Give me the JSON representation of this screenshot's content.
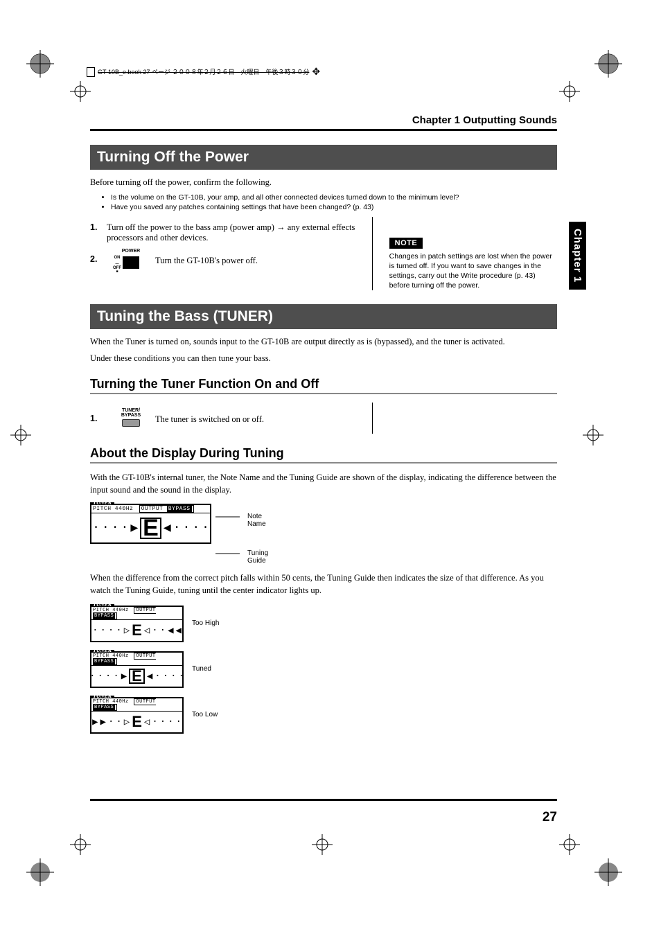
{
  "meta": {
    "header_line": "GT-10B_e.book  27 ページ  ２００８年２月２６日　火曜日　午後３時３０分"
  },
  "chapter_header": "Chapter 1 Outputting Sounds",
  "side_tab": "Chapter 1",
  "page_number": "27",
  "section1": {
    "title": "Turning Off the Power",
    "intro": "Before turning off the power, confirm the following.",
    "bullets": [
      "Is the volume on the GT-10B, your amp, and all other connected devices turned down to the minimum level?",
      "Have you saved any patches containing settings that have been changed? (p. 43)"
    ],
    "step1_num": "1.",
    "step1": "Turn off the power to the bass amp (power amp) → any external effects processors and other devices.",
    "step2_num": "2.",
    "step2_icon_top": "POWER",
    "step2_on": "ON",
    "step2_off": "OFF",
    "step2": "Turn the GT-10B's power off.",
    "note_label": "NOTE",
    "note": "Changes in patch settings are lost when the power is turned off. If you want to save changes in the settings, carry out the Write procedure (p. 43) before turning off the power."
  },
  "section2": {
    "title": "Tuning the Bass (TUNER)",
    "p1": "When the Tuner is turned on, sounds input to the GT-10B are output directly as is (bypassed), and the tuner is activated.",
    "p2": "Under these conditions you can then tune your bass.",
    "sub1": {
      "title": "Turning the Tuner Function On and Off",
      "step1_num": "1.",
      "step1_icon_top": "TUNER/\nBYPASS",
      "step1": "The tuner is switched on or off."
    },
    "sub2": {
      "title": "About the Display During Tuning",
      "p1": "With the GT-10B's internal tuner, the Note Name and the Tuning Guide are shown of the display, indicating the difference between the input sound and the sound in the display.",
      "callout_note_name": "Note Name",
      "callout_tuning_guide": "Tuning Guide",
      "p2": "When the difference from the correct pitch falls within 50 cents, the Tuning Guide then indicates the size of that difference. As you watch the Tuning Guide, tuning until the center indicator lights up.",
      "label_too_high": "Too High",
      "label_tuned": "Tuned",
      "label_too_low": "Too Low"
    },
    "tuner": {
      "tab": "TUNER",
      "pitch": "PITCH 440Hz",
      "output": "OUTPUT",
      "bypass": "BYPASS",
      "note": "E"
    }
  }
}
